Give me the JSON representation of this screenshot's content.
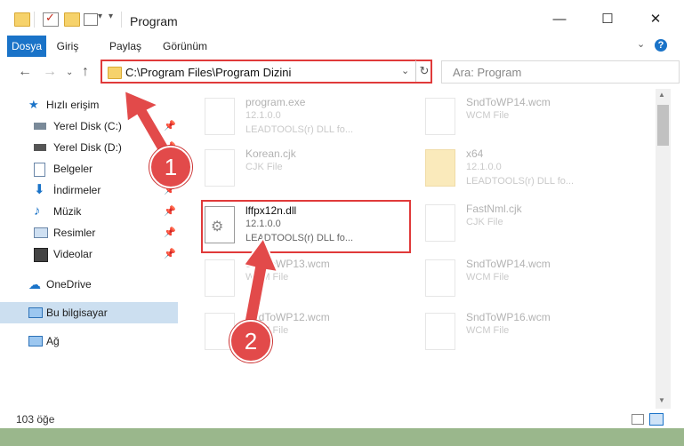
{
  "window": {
    "title": "Program"
  },
  "ribbon": {
    "tabs": [
      "Dosya",
      "Giriş",
      "Paylaş",
      "Görünüm"
    ]
  },
  "address": {
    "path": "C:\\Program Files\\Program Dizini"
  },
  "search": {
    "placeholder": "Ara: Program"
  },
  "sidebar": {
    "quick_access": "Hızlı erişim",
    "items": [
      {
        "label": "Yerel Disk (C:)",
        "icon": "drive-icon"
      },
      {
        "label": "Yerel Disk (D:)",
        "icon": "drive-icon"
      },
      {
        "label": "Belgeler",
        "icon": "documents-icon"
      },
      {
        "label": "İndirmeler",
        "icon": "download-icon"
      },
      {
        "label": "Müzik",
        "icon": "music-icon"
      },
      {
        "label": "Resimler",
        "icon": "pictures-icon"
      },
      {
        "label": "Videolar",
        "icon": "videos-icon"
      }
    ],
    "onedrive": "OneDrive",
    "this_pc": "Bu bilgisayar",
    "network": "Ağ"
  },
  "files": [
    {
      "name": "program.exe",
      "line2": "12.1.0.0",
      "line3": "LEADTOOLS(r) DLL fo..."
    },
    {
      "name": "SndToWP14.wcm",
      "line2": "WCM File",
      "line3": ""
    },
    {
      "name": "Korean.cjk",
      "line2": "CJK File",
      "line3": ""
    },
    {
      "name": "x64",
      "line2": "12.1.0.0",
      "line3": "LEADTOOLS(r) DLL fo..."
    },
    {
      "name": "lffpx12n.dll",
      "line2": "12.1.0.0",
      "line3": "LEADTOOLS(r) DLL fo..."
    },
    {
      "name": "FastNml.cjk",
      "line2": "CJK File",
      "line3": ""
    },
    {
      "name": "SndToWP13.wcm",
      "line2": "WCM File",
      "line3": ""
    },
    {
      "name": "SndToWP14.wcm",
      "line2": "WCM File",
      "line3": ""
    },
    {
      "name": "SndToWP12.wcm",
      "line2": "WCM File",
      "line3": ""
    },
    {
      "name": "SndToWP16.wcm",
      "line2": "WCM File",
      "line3": ""
    }
  ],
  "status": {
    "count": "103 öğe"
  },
  "annotations": {
    "step1": "1",
    "step2": "2"
  },
  "colors": {
    "accent": "#1a73c8",
    "highlight": "#e03a3a"
  }
}
